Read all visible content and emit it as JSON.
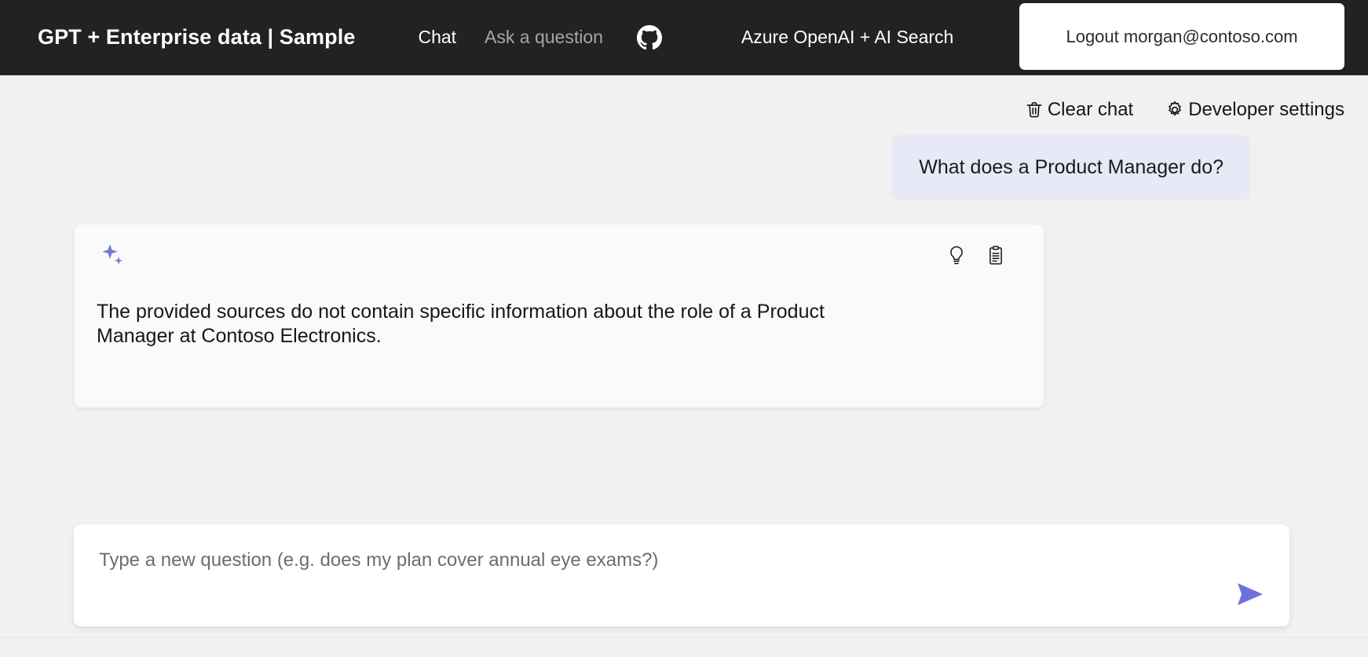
{
  "header": {
    "app_title": "GPT + Enterprise data | Sample",
    "nav": [
      {
        "label": "Chat",
        "state": "active",
        "icon": ""
      },
      {
        "label": "Ask a question",
        "state": "inactive",
        "icon": ""
      }
    ],
    "github_icon": "github-icon",
    "brand_text": "Azure OpenAI + AI Search",
    "logout_label": "Logout morgan@contoso.com",
    "bg_color": "#222222"
  },
  "commands": {
    "clear_chat_label": "Clear chat",
    "clear_chat_icon": "trash-icon",
    "developer_settings_label": "Developer settings",
    "developer_settings_icon": "gear-icon"
  },
  "chat": {
    "user_message": "What does a Product Manager do?",
    "user_bubble_color": "#e7e9f6",
    "answer": {
      "sparkle_icon": "sparkle-icon",
      "sparkle_color": "#7478d4",
      "text": "The provided sources do not contain specific information about the role of a Product Manager at Contoso Electronics.",
      "actions": [
        {
          "icon": "lightbulb-icon",
          "name": "show-thought-process"
        },
        {
          "icon": "clipboard-icon",
          "name": "show-supporting-content"
        }
      ]
    }
  },
  "question_input": {
    "value": "",
    "placeholder": "Type a new question (e.g. does my plan cover annual eye exams?)",
    "send_icon": "send-icon",
    "send_color": "#6e72d8"
  },
  "colors": {
    "page_bg": "#f1f1f1",
    "card_bg": "#fafafa",
    "accent": "#6e72d8"
  }
}
